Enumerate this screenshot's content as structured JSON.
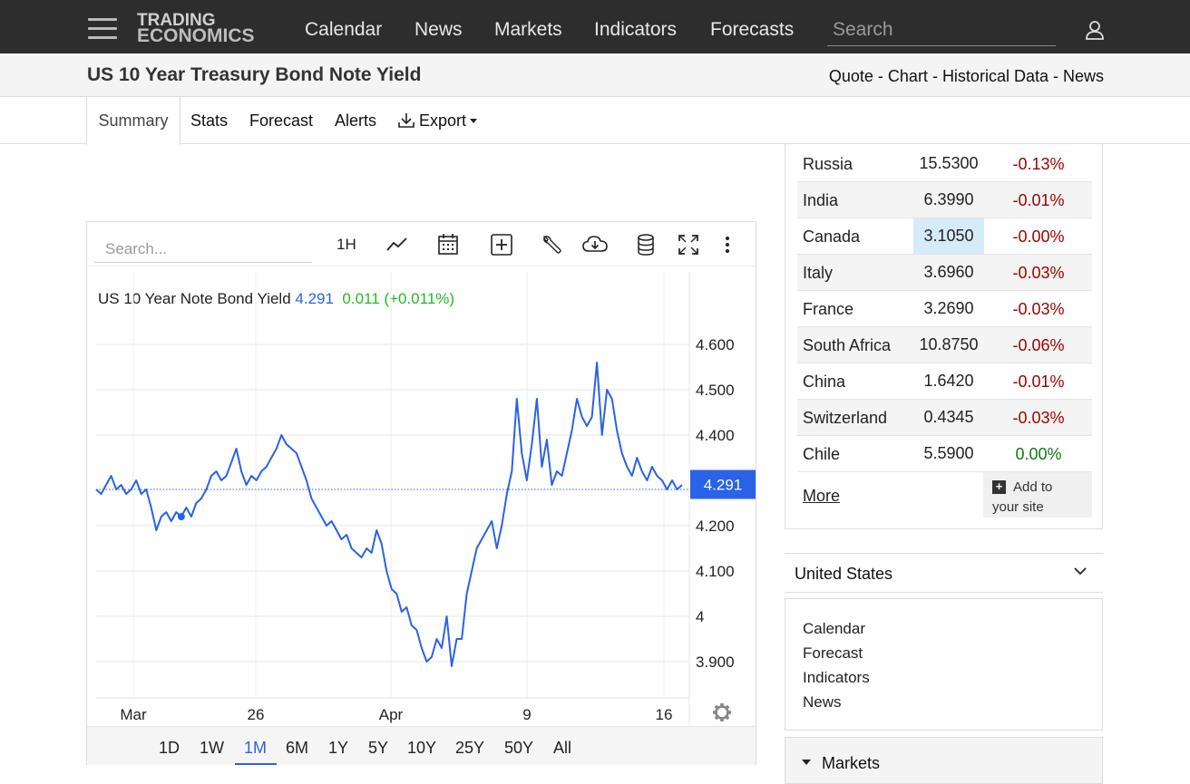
{
  "nav": {
    "logo_line1": "TRADING",
    "logo_line2": "ECONOMICS",
    "links": [
      "Calendar",
      "News",
      "Markets",
      "Indicators",
      "Forecasts"
    ],
    "search_placeholder": "Search"
  },
  "header": {
    "title": "US 10 Year Treasury Bond Note Yield",
    "quick_links": [
      "Quote",
      "Chart",
      "Historical Data",
      "News"
    ],
    "separator": " - "
  },
  "tabs": [
    "Summary",
    "Stats",
    "Forecast",
    "Alerts",
    "Export"
  ],
  "chart_panel": {
    "search_placeholder": "Search...",
    "interval_label": "1H",
    "tools": [
      "line-chart-icon",
      "calendar-icon",
      "plus-box-icon",
      "wrench-icon",
      "cloud-download-icon",
      "database-icon",
      "fullscreen-icon",
      "more-vert-icon"
    ],
    "legend": {
      "name": "US 10 Year Note Bond Yield",
      "value": "4.291",
      "change": "0.011 (+0.011%)"
    },
    "price_tag": "4.291",
    "ranges": [
      "1D",
      "1W",
      "1M",
      "6M",
      "1Y",
      "5Y",
      "10Y",
      "25Y",
      "50Y",
      "All"
    ],
    "active_range": "1M",
    "settings_icon": "gear-icon"
  },
  "chart_data": {
    "type": "line",
    "series": [
      {
        "name": "US 10 Year Note Bond Yield",
        "color": "#2a62e8",
        "values": [
          4.28,
          4.27,
          4.29,
          4.31,
          4.28,
          4.29,
          4.27,
          4.28,
          4.3,
          4.27,
          4.28,
          4.24,
          4.19,
          4.22,
          4.23,
          4.21,
          4.23,
          4.22,
          4.24,
          4.22,
          4.25,
          4.26,
          4.28,
          4.31,
          4.32,
          4.3,
          4.31,
          4.34,
          4.37,
          4.32,
          4.29,
          4.31,
          4.3,
          4.32,
          4.33,
          4.35,
          4.37,
          4.4,
          4.38,
          4.37,
          4.36,
          4.33,
          4.3,
          4.26,
          4.24,
          4.22,
          4.2,
          4.21,
          4.19,
          4.17,
          4.18,
          4.15,
          4.14,
          4.13,
          4.15,
          4.14,
          4.19,
          4.16,
          4.1,
          4.06,
          4.05,
          4.01,
          4.02,
          3.98,
          3.97,
          3.93,
          3.9,
          3.91,
          3.95,
          3.93,
          4.0,
          3.89,
          3.95,
          3.95,
          4.05,
          4.1,
          4.15,
          4.17,
          4.19,
          4.21,
          4.15,
          4.2,
          4.27,
          4.32,
          4.48,
          4.36,
          4.3,
          4.38,
          4.48,
          4.33,
          4.39,
          4.29,
          4.32,
          4.31,
          4.36,
          4.41,
          4.48,
          4.44,
          4.42,
          4.44,
          4.56,
          4.4,
          4.5,
          4.48,
          4.41,
          4.36,
          4.33,
          4.31,
          4.35,
          4.32,
          4.3,
          4.33,
          4.31,
          4.3,
          4.28,
          4.3,
          4.28,
          4.29
        ],
        "last": 4.291,
        "reference_line": 4.28
      }
    ],
    "x_tick_labels": [
      "Mar",
      "26",
      "Apr",
      "9",
      "16"
    ],
    "y_tick_labels": [
      "4.600",
      "4.500",
      "4.400",
      "4.200",
      "4.100",
      "4",
      "3.900"
    ],
    "y_ticks": [
      4.6,
      4.5,
      4.4,
      4.2,
      4.1,
      4.0,
      3.9
    ],
    "ylim": [
      3.82,
      4.67
    ],
    "grid": true
  },
  "sidebar": {
    "rows": [
      {
        "name": "Russia",
        "price": "15.5300",
        "change": "-0.13%",
        "dir": "neg",
        "highlight": false
      },
      {
        "name": "India",
        "price": "6.3990",
        "change": "-0.01%",
        "dir": "neg",
        "highlight": false
      },
      {
        "name": "Canada",
        "price": "3.1050",
        "change": "-0.00%",
        "dir": "neg",
        "highlight": true
      },
      {
        "name": "Italy",
        "price": "3.6960",
        "change": "-0.03%",
        "dir": "neg",
        "highlight": false
      },
      {
        "name": "France",
        "price": "3.2690",
        "change": "-0.03%",
        "dir": "neg",
        "highlight": false
      },
      {
        "name": "South Africa",
        "price": "10.8750",
        "change": "-0.06%",
        "dir": "neg",
        "highlight": false
      },
      {
        "name": "China",
        "price": "1.6420",
        "change": "-0.01%",
        "dir": "neg",
        "highlight": false
      },
      {
        "name": "Switzerland",
        "price": "0.4345",
        "change": "-0.03%",
        "dir": "neg",
        "highlight": false
      },
      {
        "name": "Chile",
        "price": "5.5900",
        "change": "0.00%",
        "dir": "pos",
        "highlight": false
      }
    ],
    "more_label": "More",
    "add_site_line1": "Add to",
    "add_site_line2": "your site",
    "country_header": "United States",
    "country_links": [
      "Calendar",
      "Forecast",
      "Indicators",
      "News"
    ],
    "markets_header": "Markets"
  }
}
